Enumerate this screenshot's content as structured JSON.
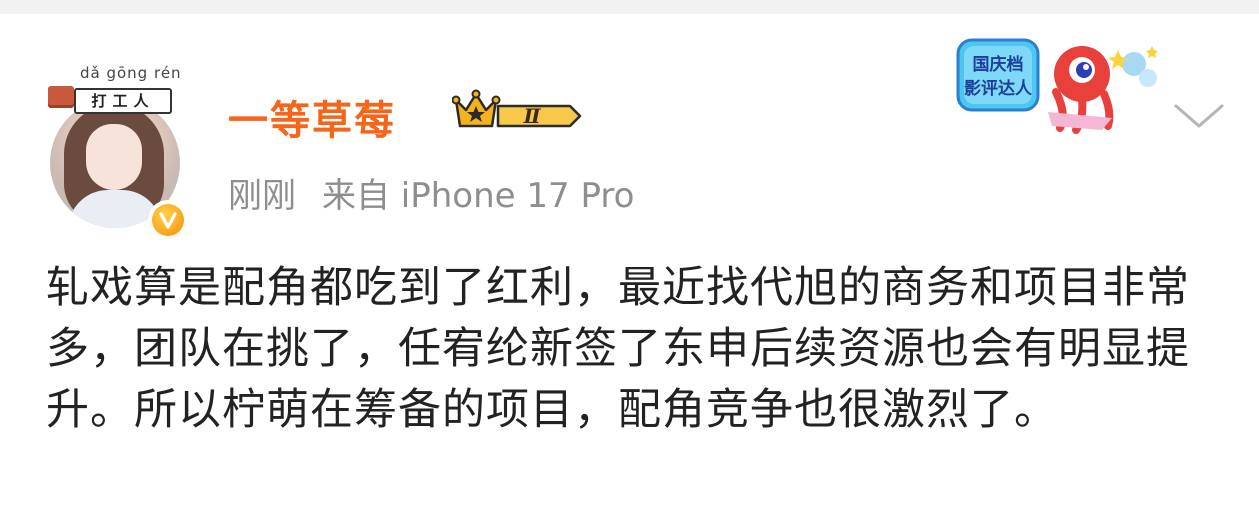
{
  "user": {
    "name": "一等草莓",
    "badge_level": "Ⅱ",
    "avatar_frame": {
      "pinyin": "dǎ gōng rén",
      "sign_text": "打工人"
    },
    "verified_symbol": "V"
  },
  "post": {
    "time": "刚刚",
    "source": "来自 iPhone 17 Pro",
    "text": "轧戏算是配角都吃到了红利，最近找代旭的商务和项目非常多，团队在挑了，任宥纶新签了东申后续资源也会有明显提升。所以柠萌在筹备的项目，配角竞争也很激烈了。"
  },
  "promo": {
    "line1": "国庆档",
    "line2": "影评达人"
  },
  "colors": {
    "name": "#f6651a",
    "meta": "#8e8e8e",
    "body_text": "#222222",
    "gold": "#f5b21d"
  },
  "icons": {
    "chevron": "chevron-down-icon",
    "verified": "verified-badge-icon",
    "crown": "crown-icon"
  }
}
